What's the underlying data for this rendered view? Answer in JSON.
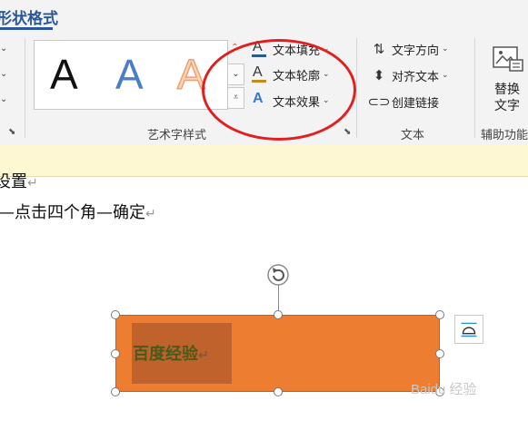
{
  "ribbon": {
    "active_tab": "形状格式",
    "wordart_group": {
      "label": "艺术字样式",
      "gallery_items": [
        "A",
        "A",
        "A"
      ],
      "text_fill": "文本填充",
      "text_outline": "文本轮廓",
      "text_effect": "文本效果"
    },
    "text_group": {
      "label": "文本",
      "text_direction": "文字方向",
      "align_text": "对齐文本",
      "create_link": "创建链接"
    },
    "accessibility_group": {
      "label": "辅助功能",
      "alt_text_line1": "替换",
      "alt_text_line2": "文字"
    }
  },
  "document": {
    "line1": "设置",
    "line2": "—点击四个角—确定",
    "para_mark": "↵",
    "shape_text": "百度经验"
  },
  "watermark": "Baidu 经验",
  "icons": {
    "dropdown": "chevron-down-icon",
    "launcher": "dialog-launcher-icon",
    "rotate": "rotate-handle-icon",
    "layout": "layout-options-icon",
    "alt_text": "alt-text-icon"
  },
  "colors": {
    "accent": "#2b579a",
    "shape_fill": "#ed7d31",
    "annotation": "#e02020",
    "info_bar": "#fdf7d2"
  }
}
